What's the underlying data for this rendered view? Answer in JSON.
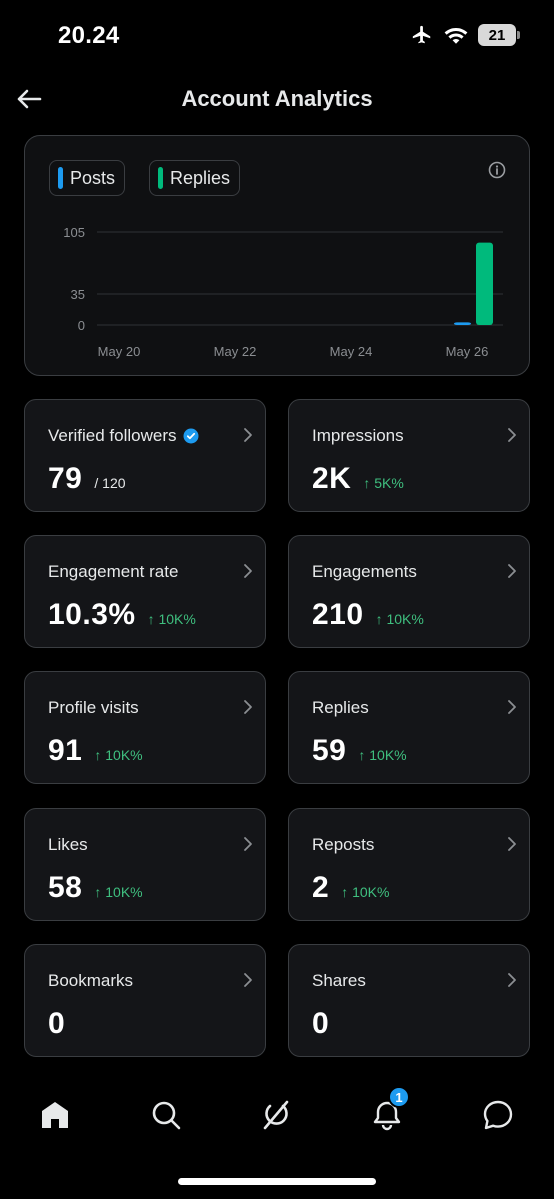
{
  "status_bar": {
    "time": "20.24",
    "battery": "21"
  },
  "header": {
    "title": "Account Analytics"
  },
  "legend": [
    {
      "label": "Posts",
      "color": "#1d9bf0"
    },
    {
      "label": "Replies",
      "color": "#00ba7c"
    }
  ],
  "chart_data": {
    "type": "bar",
    "x_tick_labels": [
      "May 20",
      "May 22",
      "May 24",
      "May 26"
    ],
    "y_ticks": [
      0,
      35,
      105
    ],
    "ylim": [
      0,
      105
    ],
    "categories": [
      "May 26"
    ],
    "series": [
      {
        "name": "Posts",
        "color": "#1d9bf0",
        "values": [
          3
        ]
      },
      {
        "name": "Replies",
        "color": "#00ba7c",
        "values": [
          93
        ]
      }
    ],
    "grid": true
  },
  "stats": [
    {
      "label": "Verified followers",
      "value": "79",
      "sub": "/ 120",
      "change": "",
      "verified": true
    },
    {
      "label": "Impressions",
      "value": "2K",
      "sub": "",
      "change": "↑ 5K%"
    },
    {
      "label": "Engagement rate",
      "value": "10.3%",
      "sub": "",
      "change": "↑ 10K%"
    },
    {
      "label": "Engagements",
      "value": "210",
      "sub": "",
      "change": "↑ 10K%"
    },
    {
      "label": "Profile visits",
      "value": "91",
      "sub": "",
      "change": "↑ 10K%"
    },
    {
      "label": "Replies",
      "value": "59",
      "sub": "",
      "change": "↑ 10K%"
    },
    {
      "label": "Likes",
      "value": "58",
      "sub": "",
      "change": "↑ 10K%"
    },
    {
      "label": "Reposts",
      "value": "2",
      "sub": "",
      "change": "↑ 10K%"
    },
    {
      "label": "Bookmarks",
      "value": "0",
      "sub": "",
      "change": ""
    },
    {
      "label": "Shares",
      "value": "0",
      "sub": "",
      "change": ""
    }
  ],
  "nav": {
    "notifications_badge": "1"
  },
  "colors": {
    "accent": "#1d9bf0",
    "positive": "#3fbf7f",
    "replies": "#00ba7c"
  }
}
